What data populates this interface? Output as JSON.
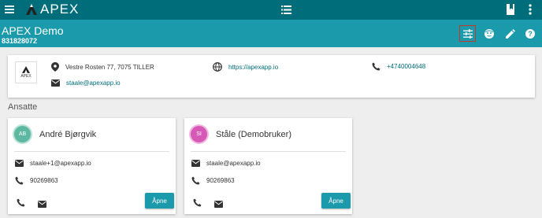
{
  "topbar": {
    "brand": "APEX",
    "icons": [
      "menu-icon",
      "apex-logo-icon",
      "list-icon",
      "book-icon",
      "more-vert-icon"
    ]
  },
  "subheader": {
    "title": "APEX Demo",
    "org_number": "831828072",
    "actions": [
      "tune-icon",
      "face-icon",
      "edit-icon",
      "help-icon"
    ]
  },
  "company": {
    "logo_text": "APEX",
    "address": "Vestre Rosten 77, 7075 TILLER",
    "website": "https://apexapp.io",
    "phone": "+4740004648",
    "email": "staale@apexapp.io"
  },
  "employees_section": {
    "title": "Ansatte"
  },
  "employees": [
    {
      "initials": "AB",
      "name": "André Bjørgvik",
      "email": "staale+1@apexapp.io",
      "phone": "90269863",
      "open_label": "Åpne",
      "avatar_color": "#5cb8a0"
    },
    {
      "initials": "SI",
      "name": "Ståle (Demobruker)",
      "email": "staale@apexapp.io",
      "phone": "90269863",
      "open_label": "Åpne",
      "avatar_color": "#d65ab5"
    }
  ],
  "colors": {
    "topbar": "#006e7a",
    "subbar": "#1a9aaa",
    "accent": "#1a9aaa",
    "highlight_border": "#c0392b"
  }
}
